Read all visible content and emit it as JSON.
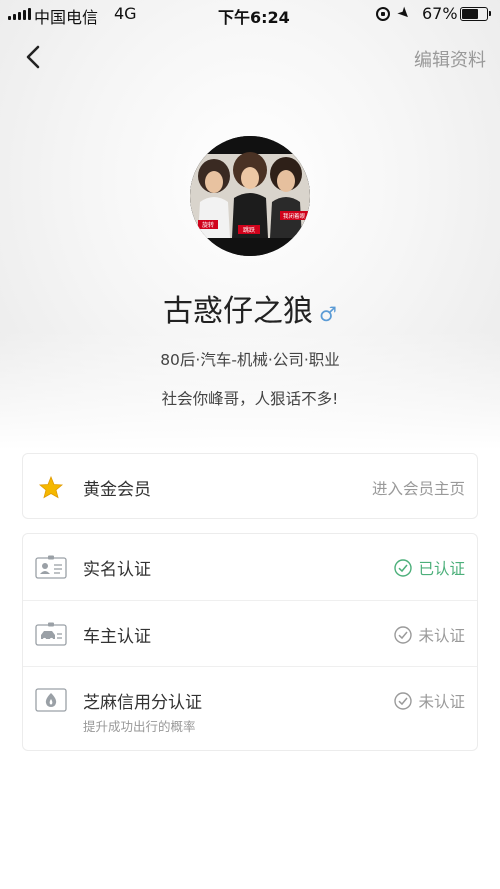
{
  "status_bar": {
    "carrier": "中国电信",
    "network": "4G",
    "time": "下午6:24",
    "battery": "67%"
  },
  "nav": {
    "edit_label": "编辑资料"
  },
  "profile": {
    "username": "古惑仔之狼",
    "gender_symbol": "♂",
    "tags": "80后·汽车-机械·公司·职业",
    "bio": "社会你峰哥，人狠话不多!",
    "avatar_labels": [
      "旋转",
      "跳跃",
      "我闭着眼"
    ]
  },
  "member": {
    "label": "黄金会员",
    "action": "进入会员主页",
    "icon": "star-icon"
  },
  "verifications": [
    {
      "label": "实名认证",
      "status": "已认证",
      "verified": true,
      "icon": "id-card-icon",
      "sub": ""
    },
    {
      "label": "车主认证",
      "status": "未认证",
      "verified": false,
      "icon": "car-icon",
      "sub": ""
    },
    {
      "label": "芝麻信用分认证",
      "status": "未认证",
      "verified": false,
      "icon": "sesame-icon",
      "sub": "提升成功出行的概率"
    }
  ],
  "colors": {
    "verified": "#4caf7a",
    "unverified": "#9a9a9a",
    "gender": "#5b9bd5",
    "star": "#f5b800"
  }
}
